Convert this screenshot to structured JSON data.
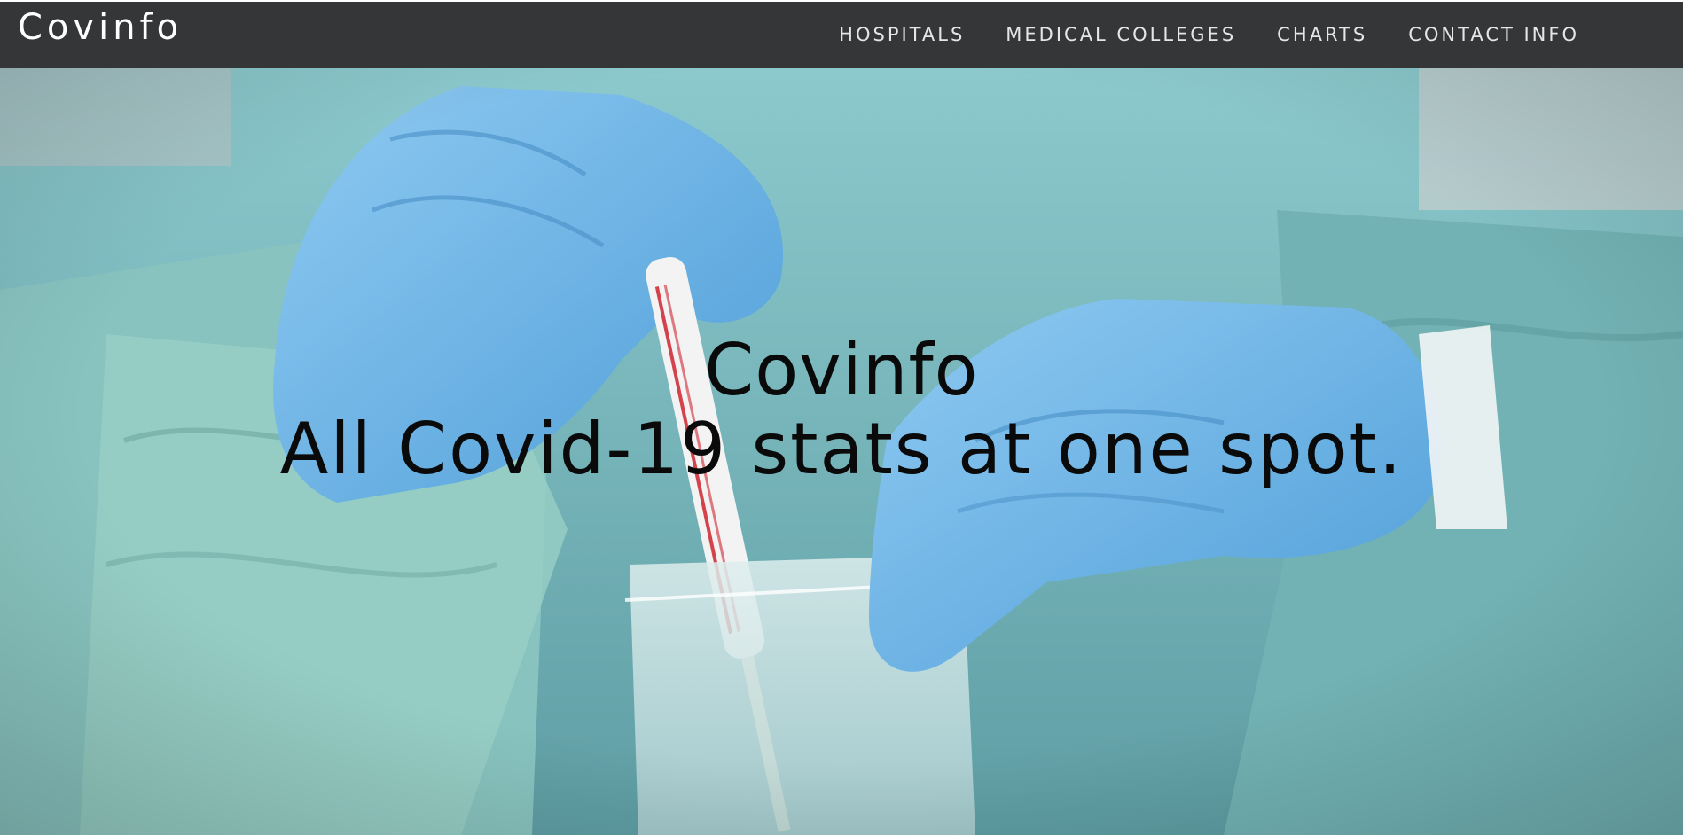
{
  "navbar": {
    "brand": "Covinfo",
    "links": [
      {
        "label": "HOSPITALS"
      },
      {
        "label": "MEDICAL COLLEGES"
      },
      {
        "label": "CHARTS"
      },
      {
        "label": "CONTACT INFO"
      }
    ]
  },
  "hero": {
    "title": "Covinfo",
    "subtitle": "All Covid-19 stats at one spot.",
    "image": "medical-worker-covid-test-swab-photo"
  },
  "colors": {
    "navbar_bg": "#343638",
    "nav_text": "#e6e6e6",
    "hero_text": "#0a0a0a",
    "gown": "#7fc0c6",
    "glove": "#6fb7ea"
  }
}
